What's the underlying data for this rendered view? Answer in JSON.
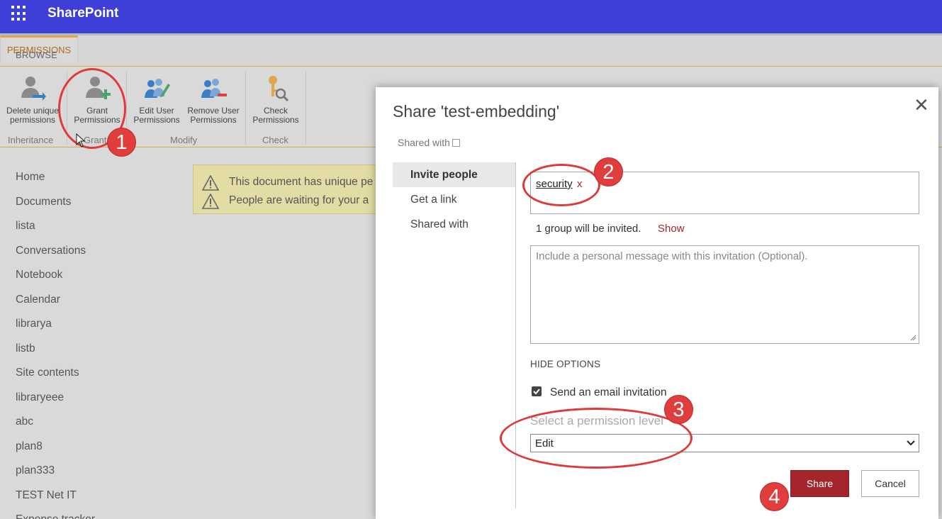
{
  "suite_bar": {
    "brand": "SharePoint",
    "waffle_icon": "app-launcher-icon",
    "color": "#3e3fd7"
  },
  "ribbon": {
    "tabs": [
      {
        "label": "BROWSE",
        "active": false
      },
      {
        "label": "PERMISSIONS",
        "active": true
      }
    ],
    "buttons": {
      "delete_unique": {
        "line1": "Delete unique",
        "line2": "permissions",
        "icon": "delete-permissions-icon"
      },
      "grant": {
        "line1": "Grant",
        "line2": "Permissions",
        "icon": "grant-permissions-icon"
      },
      "edit_user": {
        "line1": "Edit User",
        "line2": "Permissions",
        "icon": "edit-user-permissions-icon"
      },
      "remove_user": {
        "line1": "Remove User",
        "line2": "Permissions",
        "icon": "remove-user-permissions-icon"
      },
      "check": {
        "line1": "Check",
        "line2": "Permissions",
        "icon": "check-permissions-icon"
      }
    },
    "groups": {
      "inheritance": "Inheritance",
      "grant": "Grant",
      "modify": "Modify",
      "check": "Check"
    },
    "accent": "#e0a64a"
  },
  "left_nav": {
    "items": [
      "Home",
      "Documents",
      "lista",
      "Conversations",
      "Notebook",
      "Calendar",
      "librarya",
      "listb",
      "Site contents",
      "libraryeee",
      "abc",
      "plan8",
      "plan333",
      "TEST Net IT",
      "Expense tracker"
    ]
  },
  "status_bar": {
    "line1": "This document has unique pe",
    "line2": "People are waiting for your a",
    "icon": "warning-icon"
  },
  "dialog": {
    "title": "Share 'test-embedding'",
    "shared_with_label": "Shared with",
    "close_icon": "close-icon",
    "nav": [
      "Invite people",
      "Get a link",
      "Shared with"
    ],
    "people": {
      "token": "security",
      "remove": "x"
    },
    "invite_note": "1 group will be invited.",
    "show_link": "Show",
    "message_placeholder": "Include a personal message with this invitation (Optional).",
    "hide_options": "HIDE OPTIONS",
    "send_email": {
      "label": "Send an email invitation",
      "checked": true
    },
    "permission_label": "Select a permission level",
    "permission_value": "Edit",
    "share_button": "Share",
    "cancel_button": "Cancel",
    "share_color": "#a4262c"
  },
  "annotations": {
    "badges": [
      "1",
      "2",
      "3",
      "4"
    ],
    "color": "#de3a3a"
  }
}
